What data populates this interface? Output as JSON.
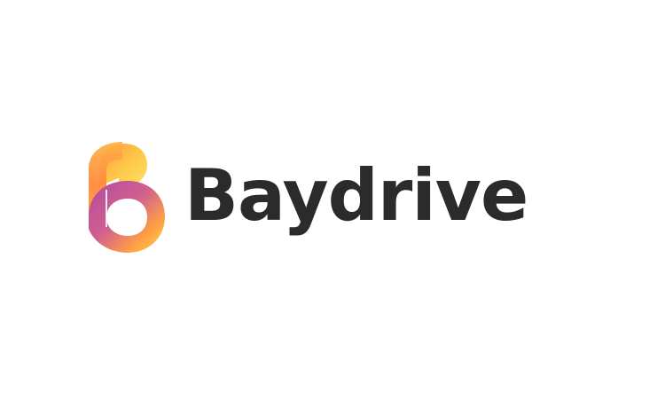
{
  "brand": {
    "name": "Baydrive",
    "logo_icon": "letter-b-gradient-icon",
    "colors": {
      "wordmark": "#2b2b2b",
      "gradient_orange": "#ff9a3c",
      "gradient_yellow": "#ffd54a",
      "gradient_magenta": "#b34aa0",
      "gradient_pink": "#e06a8c",
      "background": "#ffffff"
    }
  }
}
